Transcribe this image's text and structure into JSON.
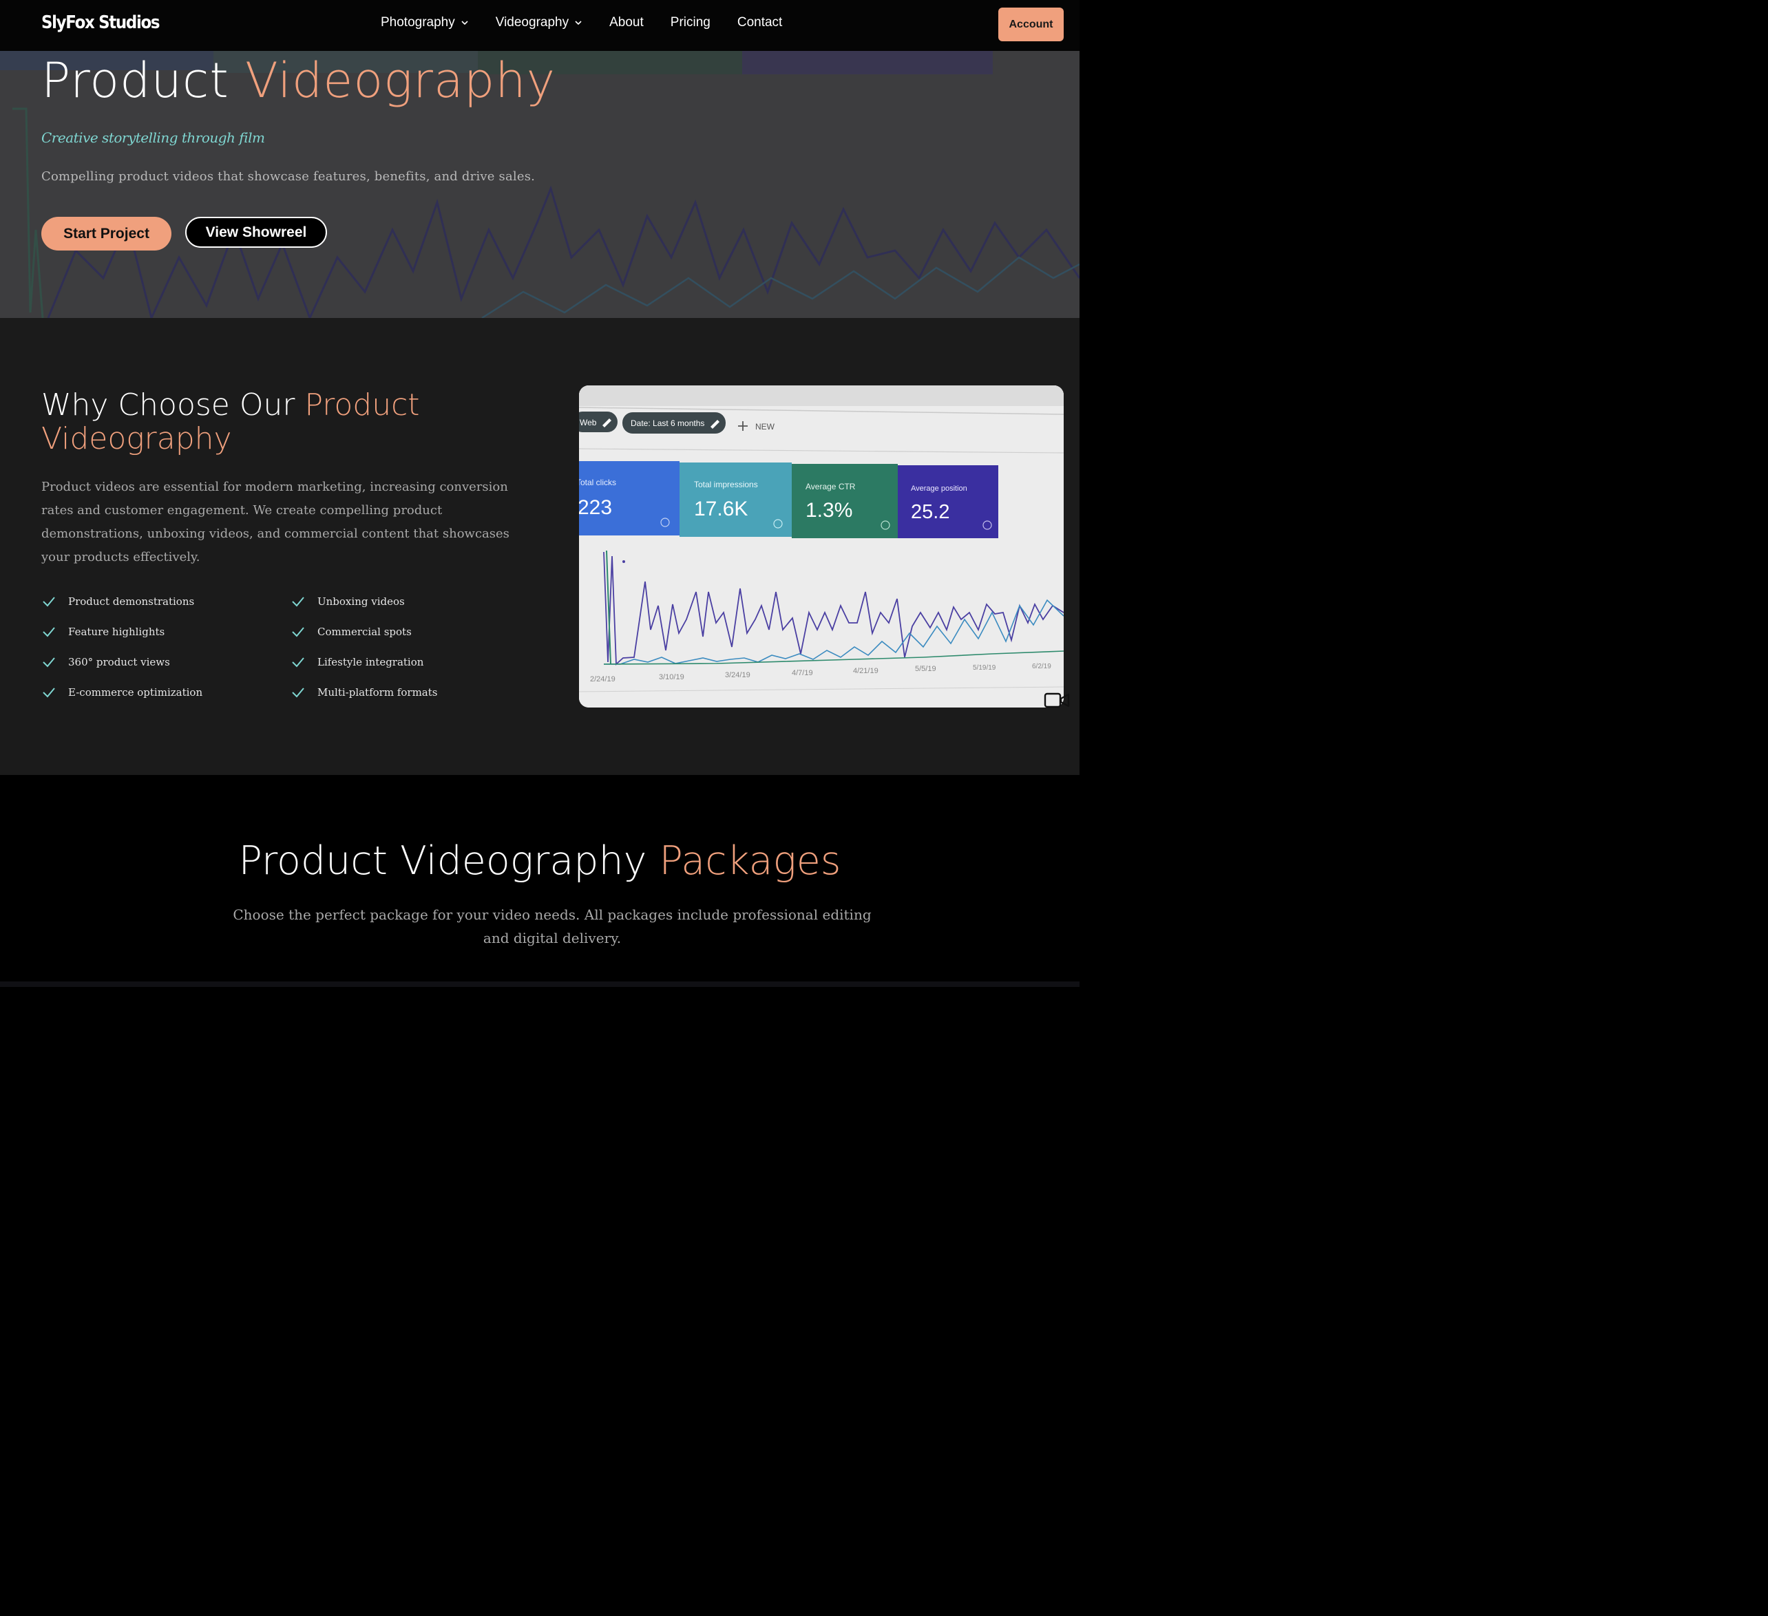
{
  "brand": {
    "logo": "SlyFox Studios",
    "accent_color": "#f0a07d",
    "teal_color": "#7fd6d1"
  },
  "nav": {
    "items": [
      {
        "label": "Photography",
        "has_dropdown": true
      },
      {
        "label": "Videography",
        "has_dropdown": true
      },
      {
        "label": "About",
        "has_dropdown": false
      },
      {
        "label": "Pricing",
        "has_dropdown": false
      },
      {
        "label": "Contact",
        "has_dropdown": false
      }
    ],
    "account_label": "Account"
  },
  "hero": {
    "title_main": "Product",
    "title_accent": "Videography",
    "tagline": "Creative storytelling through film",
    "description": "Compelling product videos that showcase features, benefits, and drive sales.",
    "primary_cta": "Start Project",
    "secondary_cta": "View Showreel"
  },
  "why": {
    "title_main": "Why Choose Our",
    "title_accent": "Product Videography",
    "description": "Product videos are essential for modern marketing, increasing conversion rates and customer engagement. We create compelling product demonstrations, unboxing videos, and commercial content that showcases your products effectively.",
    "features": [
      "Product demonstrations",
      "Unboxing videos",
      "Feature highlights",
      "Commercial spots",
      "360° product views",
      "Lifestyle integration",
      "E-commerce optimization",
      "Multi-platform formats"
    ],
    "media": {
      "chips": [
        "Web",
        "Date: Last 6 months",
        "NEW"
      ],
      "metrics": [
        {
          "label": "Total clicks",
          "value": "223",
          "color": "#3b6fd8"
        },
        {
          "label": "Total impressions",
          "value": "17.6K",
          "color": "#4aa3b8"
        },
        {
          "label": "Average CTR",
          "value": "1.3%",
          "color": "#2c7a63"
        },
        {
          "label": "Average position",
          "value": "25.2",
          "color": "#3a2fa0"
        }
      ],
      "dates": [
        "2/24/19",
        "3/10/19",
        "3/24/19",
        "4/7/19",
        "4/21/19",
        "5/5/19",
        "5/19/19",
        "6/2/19"
      ]
    }
  },
  "packages": {
    "title_main": "Product Videography",
    "title_accent": "Packages",
    "description": "Choose the perfect package for your video needs. All packages include professional editing and digital delivery."
  }
}
